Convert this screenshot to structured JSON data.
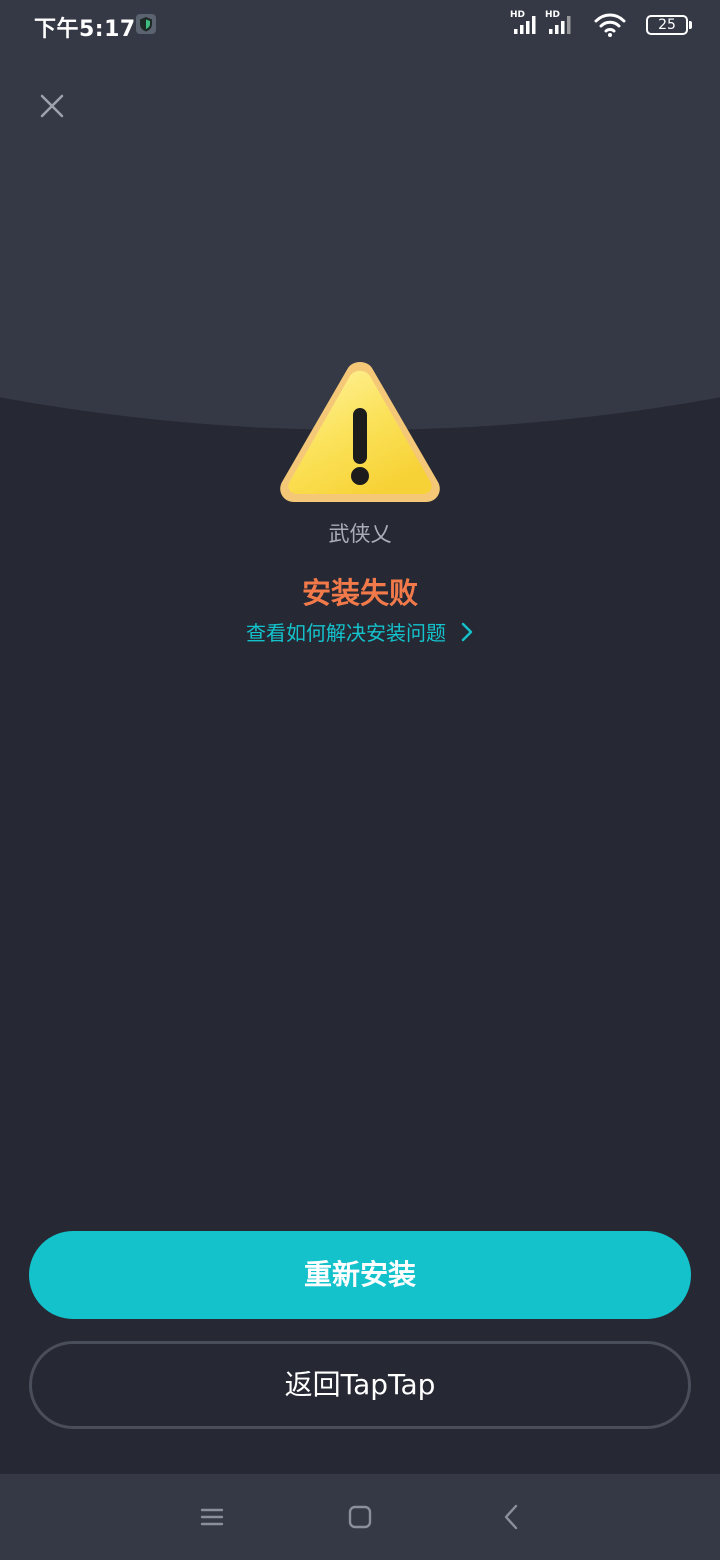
{
  "status_bar": {
    "time": "下午5:17",
    "sim1_label": "HD",
    "sim2_label": "HD",
    "battery_level": "25"
  },
  "header": {
    "close_icon": "close-icon"
  },
  "content": {
    "warning_icon": "warning-triangle-icon",
    "app_name": "武侠乂",
    "status_title": "安装失败",
    "help_link_text": "查看如何解决安装问题"
  },
  "actions": {
    "reinstall_label": "重新安装",
    "back_label": "返回TapTap"
  },
  "colors": {
    "background": "#262833",
    "header_background": "#353946",
    "accent": "#14c2cc",
    "error": "#f27a4a",
    "muted_text": "#a9adb8"
  }
}
